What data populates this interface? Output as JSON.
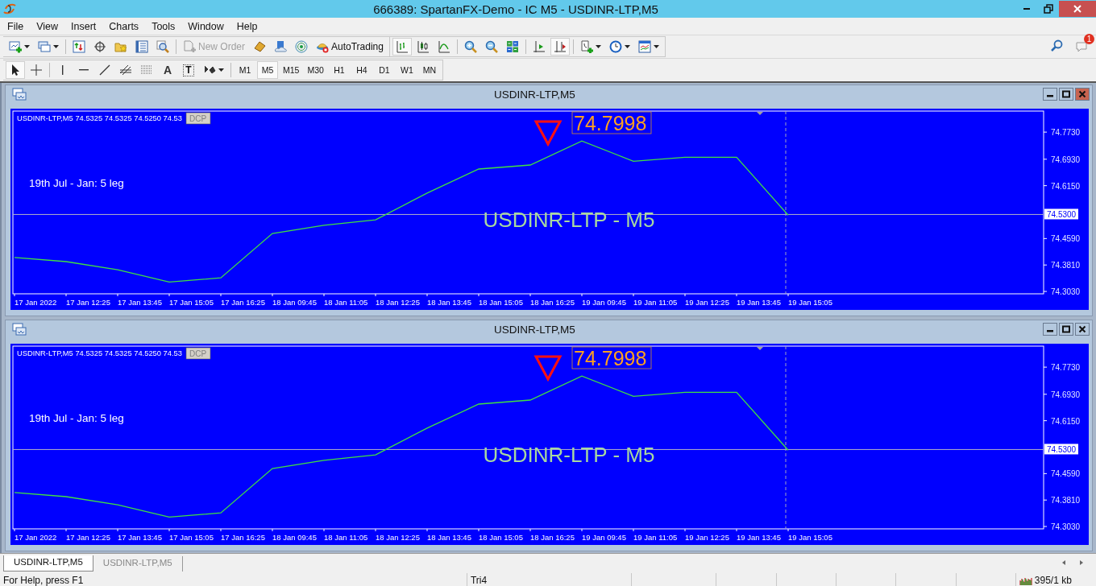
{
  "window": {
    "title": "666389: SpartanFX-Demo - IC M5 - USDINR-LTP,M5"
  },
  "menu": [
    "File",
    "View",
    "Insert",
    "Charts",
    "Tools",
    "Window",
    "Help"
  ],
  "toolbar": {
    "new_order": {
      "label": "New Order",
      "disabled": true
    },
    "auto_trading": "AutoTrading",
    "notifications": "1"
  },
  "drawing_tools": {
    "text_tool": "A",
    "label_tool": "T"
  },
  "timeframes": [
    {
      "label": "M1",
      "selected": false
    },
    {
      "label": "M5",
      "selected": true
    },
    {
      "label": "M15",
      "selected": false
    },
    {
      "label": "M30",
      "selected": false
    },
    {
      "label": "H1",
      "selected": false
    },
    {
      "label": "H4",
      "selected": false
    },
    {
      "label": "D1",
      "selected": false
    },
    {
      "label": "W1",
      "selected": false
    },
    {
      "label": "MN",
      "selected": false
    }
  ],
  "chart_windows": [
    {
      "title": "USDINR-LTP,M5",
      "active": true,
      "info": "USDINR-LTP,M5  74.5325 74.5325 74.5250 74.53",
      "dcp": "DCP",
      "note": "19th Jul - Jan: 5 leg",
      "symbol_label": "USDINR-LTP - M5",
      "price_label": "74.7998",
      "chart_data": {
        "type": "line",
        "categories": [
          "17 Jan 2022",
          "17 Jan 12:25",
          "17 Jan 13:45",
          "17 Jan 15:05",
          "17 Jan 16:25",
          "18 Jan 09:45",
          "18 Jan 11:05",
          "18 Jan 12:25",
          "18 Jan 13:45",
          "18 Jan 15:05",
          "18 Jan 16:25",
          "19 Jan 09:45",
          "19 Jan 11:05",
          "19 Jan 12:25",
          "19 Jan 13:45",
          "19 Jan 15:05"
        ],
        "series": [
          {
            "color": "#40e040",
            "values": [
              74.403,
              74.391,
              74.367,
              74.331,
              74.343,
              74.474,
              74.498,
              74.514,
              74.593,
              74.664,
              74.676,
              74.747,
              74.687,
              74.699,
              74.699,
              74.528
            ]
          }
        ],
        "ylim": [
          74.296,
          74.835
        ],
        "yticks": [
          {
            "value": 74.773,
            "label": "74.7730"
          },
          {
            "value": 74.693,
            "label": "74.6930"
          },
          {
            "value": 74.615,
            "label": "74.6150"
          },
          {
            "value": 74.459,
            "label": "74.4590"
          },
          {
            "value": 74.381,
            "label": "74.3810"
          },
          {
            "value": 74.303,
            "label": "74.3030"
          }
        ],
        "ref_lines": [
          {
            "axis": "y",
            "value": 74.53,
            "label": "74.5300"
          }
        ]
      }
    },
    {
      "title": "USDINR-LTP,M5",
      "active": false,
      "info": "USDINR-LTP,M5  74.5325 74.5325 74.5250 74.53",
      "dcp": "DCP",
      "note": "19th Jul - Jan: 5 leg",
      "symbol_label": "USDINR-LTP - M5",
      "price_label": "74.7998",
      "chart_data": {
        "type": "line",
        "categories": [
          "17 Jan 2022",
          "17 Jan 12:25",
          "17 Jan 13:45",
          "17 Jan 15:05",
          "17 Jan 16:25",
          "18 Jan 09:45",
          "18 Jan 11:05",
          "18 Jan 12:25",
          "18 Jan 13:45",
          "18 Jan 15:05",
          "18 Jan 16:25",
          "19 Jan 09:45",
          "19 Jan 11:05",
          "19 Jan 12:25",
          "19 Jan 13:45",
          "19 Jan 15:05"
        ],
        "series": [
          {
            "color": "#40e040",
            "values": [
              74.403,
              74.391,
              74.367,
              74.331,
              74.343,
              74.474,
              74.498,
              74.514,
              74.593,
              74.664,
              74.676,
              74.747,
              74.687,
              74.699,
              74.699,
              74.528
            ]
          }
        ],
        "ylim": [
          74.296,
          74.835
        ],
        "yticks": [
          {
            "value": 74.773,
            "label": "74.7730"
          },
          {
            "value": 74.693,
            "label": "74.6930"
          },
          {
            "value": 74.615,
            "label": "74.6150"
          },
          {
            "value": 74.459,
            "label": "74.4590"
          },
          {
            "value": 74.381,
            "label": "74.3810"
          },
          {
            "value": 74.303,
            "label": "74.3030"
          }
        ],
        "ref_lines": [
          {
            "axis": "y",
            "value": 74.53,
            "label": "74.5300"
          }
        ]
      }
    }
  ],
  "tabs": [
    {
      "label": "USDINR-LTP,M5",
      "selected": true
    },
    {
      "label": "USDINR-LTP,M5",
      "selected": false
    }
  ],
  "status_bar": {
    "help": "For Help, press F1",
    "profile": "Tri4",
    "traffic": "395/1 kb"
  }
}
